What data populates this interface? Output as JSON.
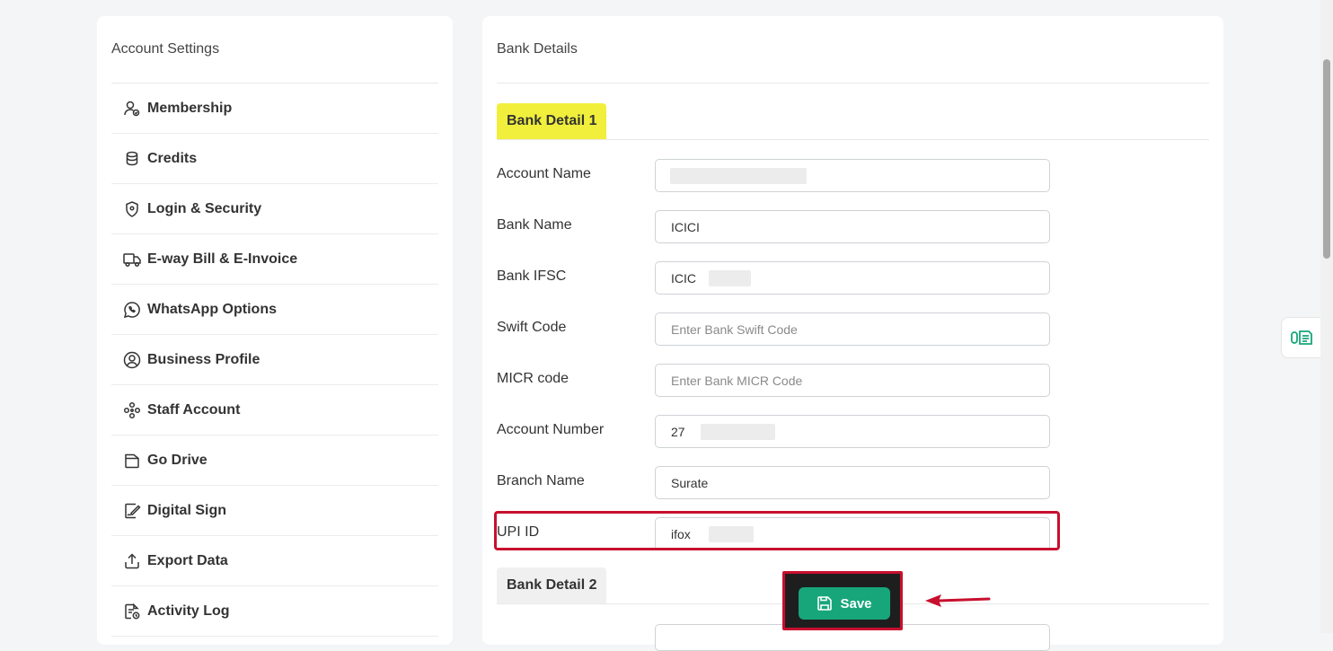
{
  "sidebar": {
    "title": "Account Settings",
    "items": [
      {
        "label": "Membership",
        "icon": "user-badge-icon"
      },
      {
        "label": "Credits",
        "icon": "coins-icon"
      },
      {
        "label": "Login & Security",
        "icon": "shield-icon"
      },
      {
        "label": "E-way Bill & E-Invoice",
        "icon": "truck-icon"
      },
      {
        "label": "WhatsApp Options",
        "icon": "whatsapp-icon"
      },
      {
        "label": "Business Profile",
        "icon": "user-circle-icon"
      },
      {
        "label": "Staff Account",
        "icon": "team-icon"
      },
      {
        "label": "Go Drive",
        "icon": "folder-icon"
      },
      {
        "label": "Digital Sign",
        "icon": "signature-icon"
      },
      {
        "label": "Export Data",
        "icon": "upload-icon"
      },
      {
        "label": "Activity Log",
        "icon": "log-icon"
      }
    ]
  },
  "main": {
    "title": "Bank Details",
    "tab1_label": "Bank Detail 1",
    "tab2_label": "Bank Detail 2",
    "fields": {
      "account_name": {
        "label": "Account Name",
        "value": "",
        "placeholder": ""
      },
      "bank_name": {
        "label": "Bank Name",
        "value": "ICICI",
        "placeholder": ""
      },
      "bank_ifsc": {
        "label": "Bank IFSC",
        "value": "ICIC",
        "placeholder": ""
      },
      "swift_code": {
        "label": "Swift Code",
        "value": "",
        "placeholder": "Enter Bank Swift Code"
      },
      "micr_code": {
        "label": "MICR code",
        "value": "",
        "placeholder": "Enter Bank MICR Code"
      },
      "account_number": {
        "label": "Account Number",
        "value": "27",
        "placeholder": ""
      },
      "branch_name": {
        "label": "Branch Name",
        "value": "Surate",
        "placeholder": ""
      },
      "upi_id": {
        "label": "UPI ID",
        "value": "ifox",
        "placeholder": ""
      }
    },
    "save_label": "Save"
  },
  "colors": {
    "accent_green": "#17a67a",
    "highlight_yellow": "#f1ef3c",
    "annotation_red": "#c8102e"
  }
}
